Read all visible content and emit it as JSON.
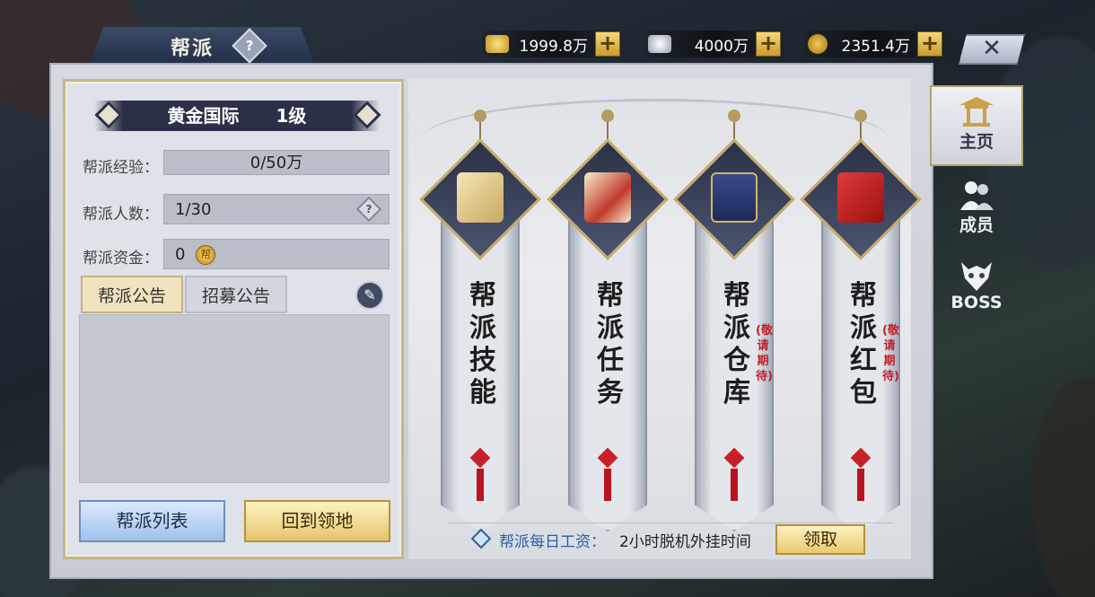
{
  "window": {
    "title": "帮派"
  },
  "currency": [
    {
      "icon": "gold-ingot-icon",
      "value": "1999.8万"
    },
    {
      "icon": "silver-ingot-icon",
      "value": "4000万"
    },
    {
      "icon": "copper-coin-icon",
      "value": "2351.4万"
    }
  ],
  "guild": {
    "name": "黄金国际",
    "level": "1级",
    "stats": [
      {
        "label": "帮派经验：",
        "value": "0/50万"
      },
      {
        "label": "帮派人数：",
        "value": "1/30"
      },
      {
        "label": "帮派资金：",
        "value": "0"
      }
    ],
    "coin_mark": "帮"
  },
  "notice_tabs": [
    "帮派公告",
    "招募公告"
  ],
  "buttons": {
    "guild_list": "帮派列表",
    "return_home": "回到领地",
    "claim": "领取"
  },
  "banners": [
    {
      "label": "帮派技能",
      "sub": ""
    },
    {
      "label": "帮派任务",
      "sub": ""
    },
    {
      "label": "帮派仓库",
      "sub": "(敬请期待)"
    },
    {
      "label": "帮派红包",
      "sub": "(敬请期待)"
    }
  ],
  "daily": {
    "label": "帮派每日工资：",
    "value": "2小时脱机外挂时间"
  },
  "side_nav": [
    {
      "label": "主页",
      "active": true
    },
    {
      "label": "成员",
      "active": false
    },
    {
      "label": "BOSS",
      "active": false
    }
  ],
  "help_mark": "?",
  "close_mark": "✕",
  "plus_mark": "+",
  "edit_mark": "✎",
  "colors": {
    "accent_gold": "#c6ab6c",
    "panel": "#d6d9df",
    "blue_text": "#2b5fa8",
    "red_text": "#c0202a"
  }
}
